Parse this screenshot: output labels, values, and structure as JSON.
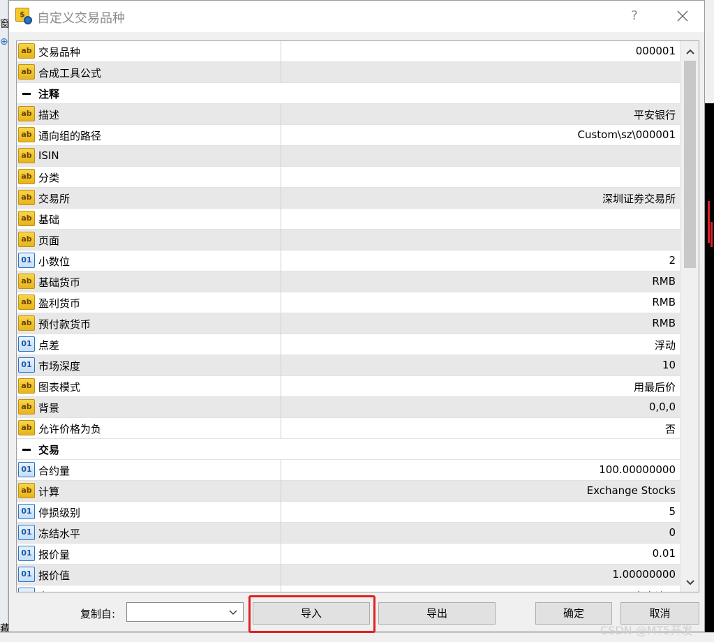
{
  "background": {
    "left_fragments": [
      "窗",
      "⊕",
      "藏"
    ]
  },
  "dialog": {
    "title": "自定义交易品种",
    "help_label": "?",
    "rows": [
      {
        "kind": "ab",
        "label": "交易品种",
        "value": "000001"
      },
      {
        "kind": "ab",
        "label": "合成工具公式",
        "value": ""
      },
      {
        "kind": "group",
        "label": "注释",
        "value": ""
      },
      {
        "kind": "ab",
        "label": "描述",
        "value": "平安银行"
      },
      {
        "kind": "ab",
        "label": "通向组的路径",
        "value": "Custom\\sz\\000001"
      },
      {
        "kind": "ab",
        "label": "ISIN",
        "value": ""
      },
      {
        "kind": "ab",
        "label": "分类",
        "value": ""
      },
      {
        "kind": "ab",
        "label": "交易所",
        "value": "深圳证券交易所"
      },
      {
        "kind": "ab",
        "label": "基础",
        "value": ""
      },
      {
        "kind": "ab",
        "label": "页面",
        "value": ""
      },
      {
        "kind": "num",
        "label": "小数位",
        "value": "2"
      },
      {
        "kind": "ab",
        "label": "基础货币",
        "value": "RMB"
      },
      {
        "kind": "ab",
        "label": "盈利货币",
        "value": "RMB"
      },
      {
        "kind": "ab",
        "label": "预付款货币",
        "value": "RMB"
      },
      {
        "kind": "num",
        "label": "点差",
        "value": "浮动"
      },
      {
        "kind": "num",
        "label": "市场深度",
        "value": "10"
      },
      {
        "kind": "ab",
        "label": "图表模式",
        "value": "用最后价"
      },
      {
        "kind": "ab",
        "label": "背景",
        "value": "0,0,0"
      },
      {
        "kind": "ab",
        "label": "允许价格为负",
        "value": "否"
      },
      {
        "kind": "group",
        "label": "交易",
        "value": ""
      },
      {
        "kind": "num",
        "label": "合约量",
        "value": "100.00000000"
      },
      {
        "kind": "ab",
        "label": "计算",
        "value": "Exchange Stocks"
      },
      {
        "kind": "num",
        "label": "停损级别",
        "value": "5"
      },
      {
        "kind": "num",
        "label": "冻结水平",
        "value": "0"
      },
      {
        "kind": "num",
        "label": "报价量",
        "value": "0.01"
      },
      {
        "kind": "num",
        "label": "报价值",
        "value": "1.00000000"
      },
      {
        "kind": "num",
        "label": "交易",
        "value": "完全访问"
      }
    ],
    "icon_text": {
      "ab": "ab",
      "num": "01"
    },
    "copy_from_label": "复制自:",
    "copy_from_value": "",
    "buttons": {
      "import": "导入",
      "export": "导出",
      "ok": "确定",
      "cancel": "取消"
    },
    "highlight_color": "#e02020"
  },
  "watermark": "CSDN @MT5开发"
}
